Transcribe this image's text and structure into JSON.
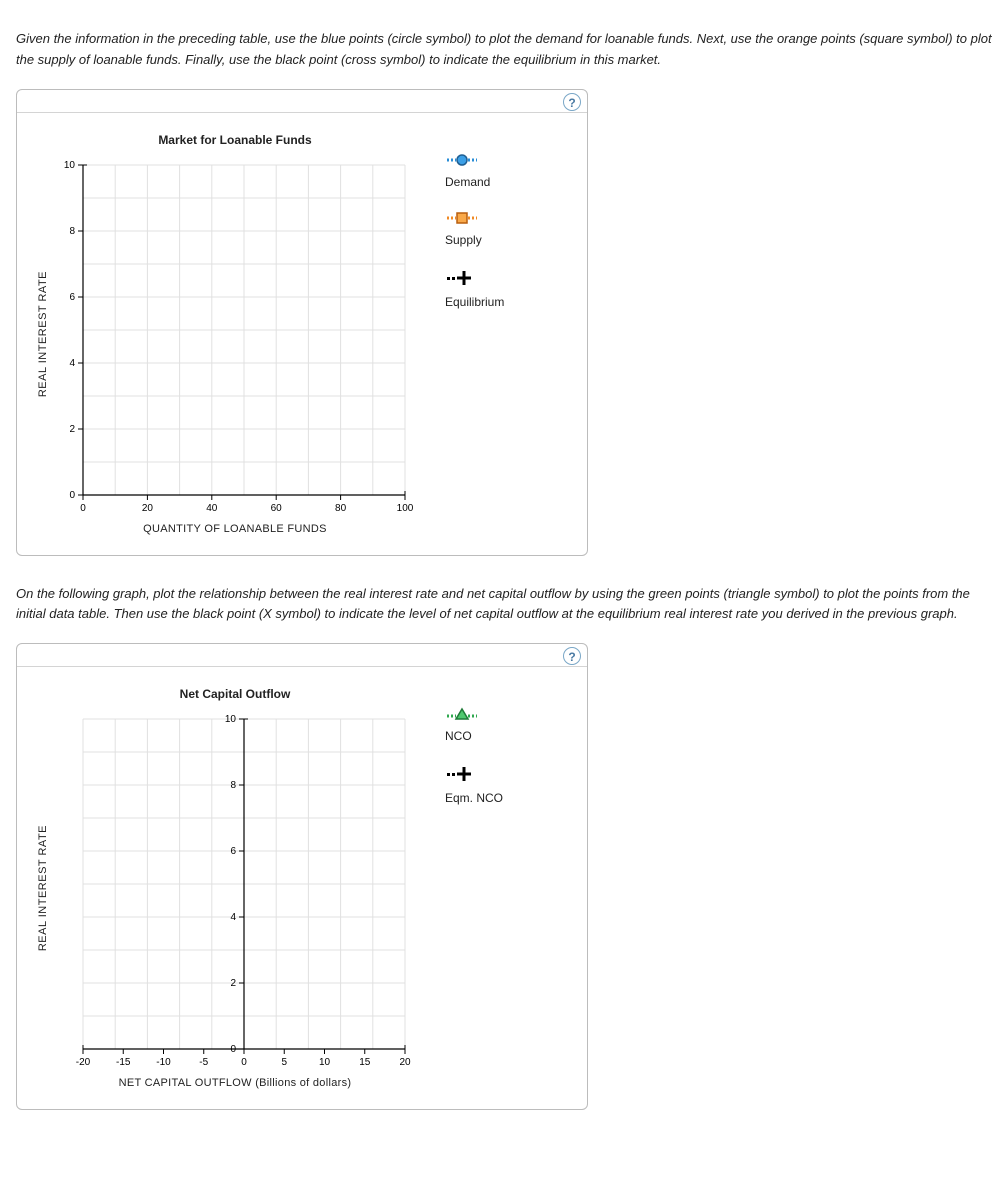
{
  "instructions": {
    "para1": "Given the information in the preceding table, use the blue points (circle symbol) to plot the demand for loanable funds. Next, use the orange points (square symbol) to plot the supply of loanable funds. Finally, use the black point (cross symbol) to indicate the equilibrium in this market.",
    "para2": "On the following graph, plot the relationship between the real interest rate and net capital outflow by using the green points (triangle symbol) to plot the points from the initial data table. Then use the black point (X symbol) to indicate the level of net capital outflow at the equilibrium real interest rate you derived in the previous graph."
  },
  "help_glyph": "?",
  "chart1": {
    "title": "Market for Loanable Funds",
    "xlabel": "QUANTITY OF LOANABLE FUNDS",
    "ylabel": "REAL INTEREST RATE",
    "legend": {
      "demand": "Demand",
      "supply": "Supply",
      "equilibrium": "Equilibrium"
    }
  },
  "chart2": {
    "title": "Net Capital Outflow",
    "xlabel": "NET CAPITAL OUTFLOW (Billions of dollars)",
    "ylabel": "REAL INTEREST RATE",
    "legend": {
      "nco": "NCO",
      "eqm_nco": "Eqm. NCO"
    }
  },
  "chart_data": [
    {
      "id": "market-for-loanable-funds",
      "type": "scatter",
      "title": "Market for Loanable Funds",
      "xlabel": "QUANTITY OF LOANABLE FUNDS",
      "ylabel": "REAL INTEREST RATE",
      "xlim": [
        0,
        100
      ],
      "ylim": [
        0,
        10
      ],
      "x_ticks": [
        0,
        20,
        40,
        60,
        80,
        100
      ],
      "y_ticks": [
        0,
        2,
        4,
        6,
        8,
        10
      ],
      "grid": true,
      "series": [
        {
          "name": "Demand",
          "symbol": "circle",
          "color": "#2a8dd6",
          "values": []
        },
        {
          "name": "Supply",
          "symbol": "square",
          "color": "#f08a24",
          "values": []
        },
        {
          "name": "Equilibrium",
          "symbol": "plus",
          "color": "#000000",
          "values": []
        }
      ],
      "legend_position": "right"
    },
    {
      "id": "net-capital-outflow",
      "type": "scatter",
      "title": "Net Capital Outflow",
      "xlabel": "NET CAPITAL OUTFLOW (Billions of dollars)",
      "ylabel": "REAL INTEREST RATE",
      "xlim": [
        -20,
        20
      ],
      "ylim": [
        0,
        10
      ],
      "x_ticks": [
        -20,
        -15,
        -10,
        -5,
        0,
        5,
        10,
        15,
        20
      ],
      "y_ticks": [
        0,
        2,
        4,
        6,
        8,
        10
      ],
      "grid": true,
      "y_axis_at_x": 0,
      "series": [
        {
          "name": "NCO",
          "symbol": "triangle",
          "color": "#2fa84f",
          "values": []
        },
        {
          "name": "Eqm. NCO",
          "symbol": "plus",
          "color": "#000000",
          "values": []
        }
      ],
      "legend_position": "right"
    }
  ]
}
